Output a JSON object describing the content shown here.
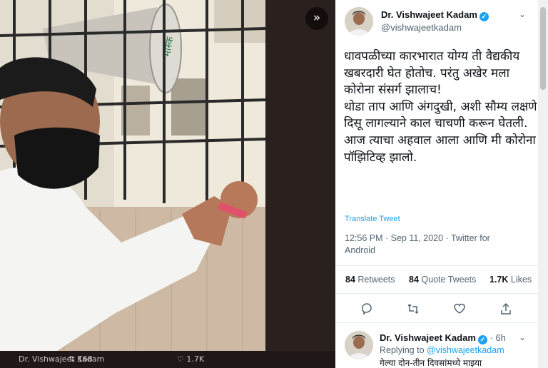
{
  "media": {
    "next_icon": "double-chevron-right-icon",
    "footer": {
      "name": "Dr. Vishwajeet Kadam",
      "reply_count": "",
      "retweet_count": "168",
      "like_count": "1.7K"
    }
  },
  "tweet": {
    "author_name": "Dr. Vishwajeet Kadam",
    "handle": "@vishwajeetkadam",
    "text": "धावपळीच्या कारभारात योग्य ती वैद्यकीय खबरदारी घेत होतोच. परंतु अखेर मला कोरोना संसर्ग झालाच!\nथोडा ताप आणि अंगदुखी, अशी सौम्य लक्षणे दिसू लागल्याने काल चाचणी करून घेतली. आज त्याचा अहवाल आला आणि मी कोरोना पॉझिटिव्ह झालो.",
    "translate_label": "Translate Tweet",
    "timestamp": "12:56 PM · Sep 11, 2020 · Twitter for Android",
    "stats": {
      "retweets_count": "84",
      "retweets_label": "Retweets",
      "quotes_count": "84",
      "quotes_label": "Quote Tweets",
      "likes_count": "1.7K",
      "likes_label": "Likes"
    }
  },
  "reply": {
    "author_name": "Dr. Vishwajeet Kadam",
    "time": "· 6h",
    "replying_prefix": "Replying to",
    "replying_handle": "@vishwajeetkadam",
    "text": "गेल्या दोन-तीन दिवसांमध्ये माझ्या"
  },
  "colors": {
    "accent": "#1da1f2",
    "verified": "#1da1f2"
  }
}
